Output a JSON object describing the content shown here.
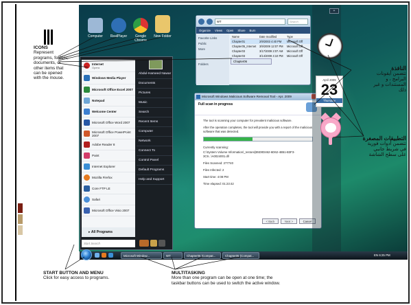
{
  "annotations": {
    "icons": {
      "title": "ICONS",
      "text": [
        "Represent",
        "programs, folders,",
        "documents, or",
        "other items that",
        "can be opened",
        "with the mouse."
      ]
    },
    "window_ar": {
      "title": "النافذة",
      "text": [
        "تتضمن أيقونات",
        "البرامج ، و",
        "المستندات و غير",
        "ذلك"
      ]
    },
    "gadgets_ar": {
      "title": "التطبيقات المصغرة",
      "text": [
        "تتضمن أدوات فورية",
        "في شريط جانبي",
        "على سطح الشاشة"
      ]
    },
    "start": {
      "title": "START BUTTON AND MENU",
      "text": "Click for easy access to programs."
    },
    "multitasking": {
      "title": "MULTITASKING",
      "text": [
        "More than one program can be open at one time; the",
        "taskbar buttons can be used to switch the active window."
      ]
    }
  },
  "desktop": {
    "icons": [
      {
        "label": "Computer",
        "color": "#9db8d6"
      },
      {
        "label": "RealPlayer",
        "color": "#2f6fb5"
      },
      {
        "label": "Google Chrome",
        "color": "#e0a33a"
      },
      {
        "label": "New Folder",
        "color": "#e9c66b"
      }
    ]
  },
  "start_menu": {
    "pinned": [
      {
        "label": "Internet",
        "sub": "Opera",
        "color": "#c22"
      },
      {
        "label": "Windows Media Player",
        "sub": "",
        "color": "#2a70b8"
      }
    ],
    "recent": [
      {
        "label": "Microsoft Office Excel 2007",
        "color": "#2c8a3c"
      },
      {
        "label": "Notepad",
        "color": "#6fa6d6"
      },
      {
        "label": "Welcome Center",
        "color": "#3d7fd0"
      },
      {
        "label": "Microsoft Office Word 2007",
        "color": "#2857a4"
      },
      {
        "label": "Microsoft Office PowerPoint 2007",
        "color": "#d0582a"
      },
      {
        "label": "Adobe Reader 8",
        "color": "#b11f1f"
      },
      {
        "label": "Paint",
        "color": "#d33b6a"
      },
      {
        "label": "Internet Explorer",
        "color": "#3b8fd6"
      },
      {
        "label": "Mozilla Firefox",
        "color": "#e57a1f"
      },
      {
        "label": "Core FTP LE",
        "color": "#2b5fa0"
      },
      {
        "label": "Safari",
        "color": "#4a8fd8"
      },
      {
        "label": "Microsoft Office Visio 2007",
        "color": "#3a62b0"
      }
    ],
    "all_programs": "All Programs",
    "search_placeholder": "Start Search",
    "right_items": [
      "Abdul-Hameed Nawar",
      "Documents",
      "Pictures",
      "Music",
      "Search",
      "Recent Items",
      "Computer",
      "Network",
      "Connect To",
      "Control Panel",
      "Default Programs",
      "Help and Support"
    ]
  },
  "explorer": {
    "address": "WT",
    "search_placeholder": "Search",
    "toolbar": [
      "Organize",
      "Views",
      "Open",
      "Share",
      "Burn"
    ],
    "side": [
      "Favorite Links",
      "Public",
      "More",
      "Folders"
    ],
    "columns": [
      "Name",
      "Date modified",
      "Type"
    ],
    "rows": [
      [
        "Chapter01",
        "2/9/2003 4:40 PM",
        "Microsoft Off"
      ],
      [
        "Chapter05_Internet",
        "3/9/2009 12:07 PM",
        "Microsoft Off"
      ],
      [
        "Chapter03",
        "3/17/2009 2:07 AM",
        "Microsoft Off"
      ],
      [
        "Chapter03",
        "3/14/2009 4:10 PM",
        "Microsoft Off"
      ]
    ],
    "task_label": "Chapter06"
  },
  "dialog": {
    "title": "Microsoft Windows Malicious Software Removal Tool - Apr. 2009",
    "heading": "Full scan in progress",
    "p1": "The tool is scanning your computer for prevalent malicious software.",
    "p2": "After the operation completes, the tool will provide you with a report of the malicious software that was detected.",
    "currently_label": "Currently scanning:",
    "current_path": "C:\\System Volume Information\\_restore{B5D0D462-6D62-4B51-B3F3-3C9...\\A0024001.dll",
    "files_scanned": "Files Scanned: 277740",
    "files_infected": "Files Infected: 2",
    "start_time": "Start time: 4:08 PM",
    "time_elapsed": "Time elapsed: 01:23:42",
    "progress": 0.45,
    "buttons": [
      "< Back",
      "Next >",
      "Cancel"
    ]
  },
  "gadgets": {
    "plus": "+",
    "calendar_month": "April 2009",
    "calendar_day": "23",
    "calendar_weekday": "Thursday"
  },
  "taskbar": {
    "buttons": [
      "Microsoft Window...",
      "WT",
      "Chapter06 (Compat...",
      "Chapter05 (Compat..."
    ],
    "tray": "EN  6:25 PM"
  }
}
